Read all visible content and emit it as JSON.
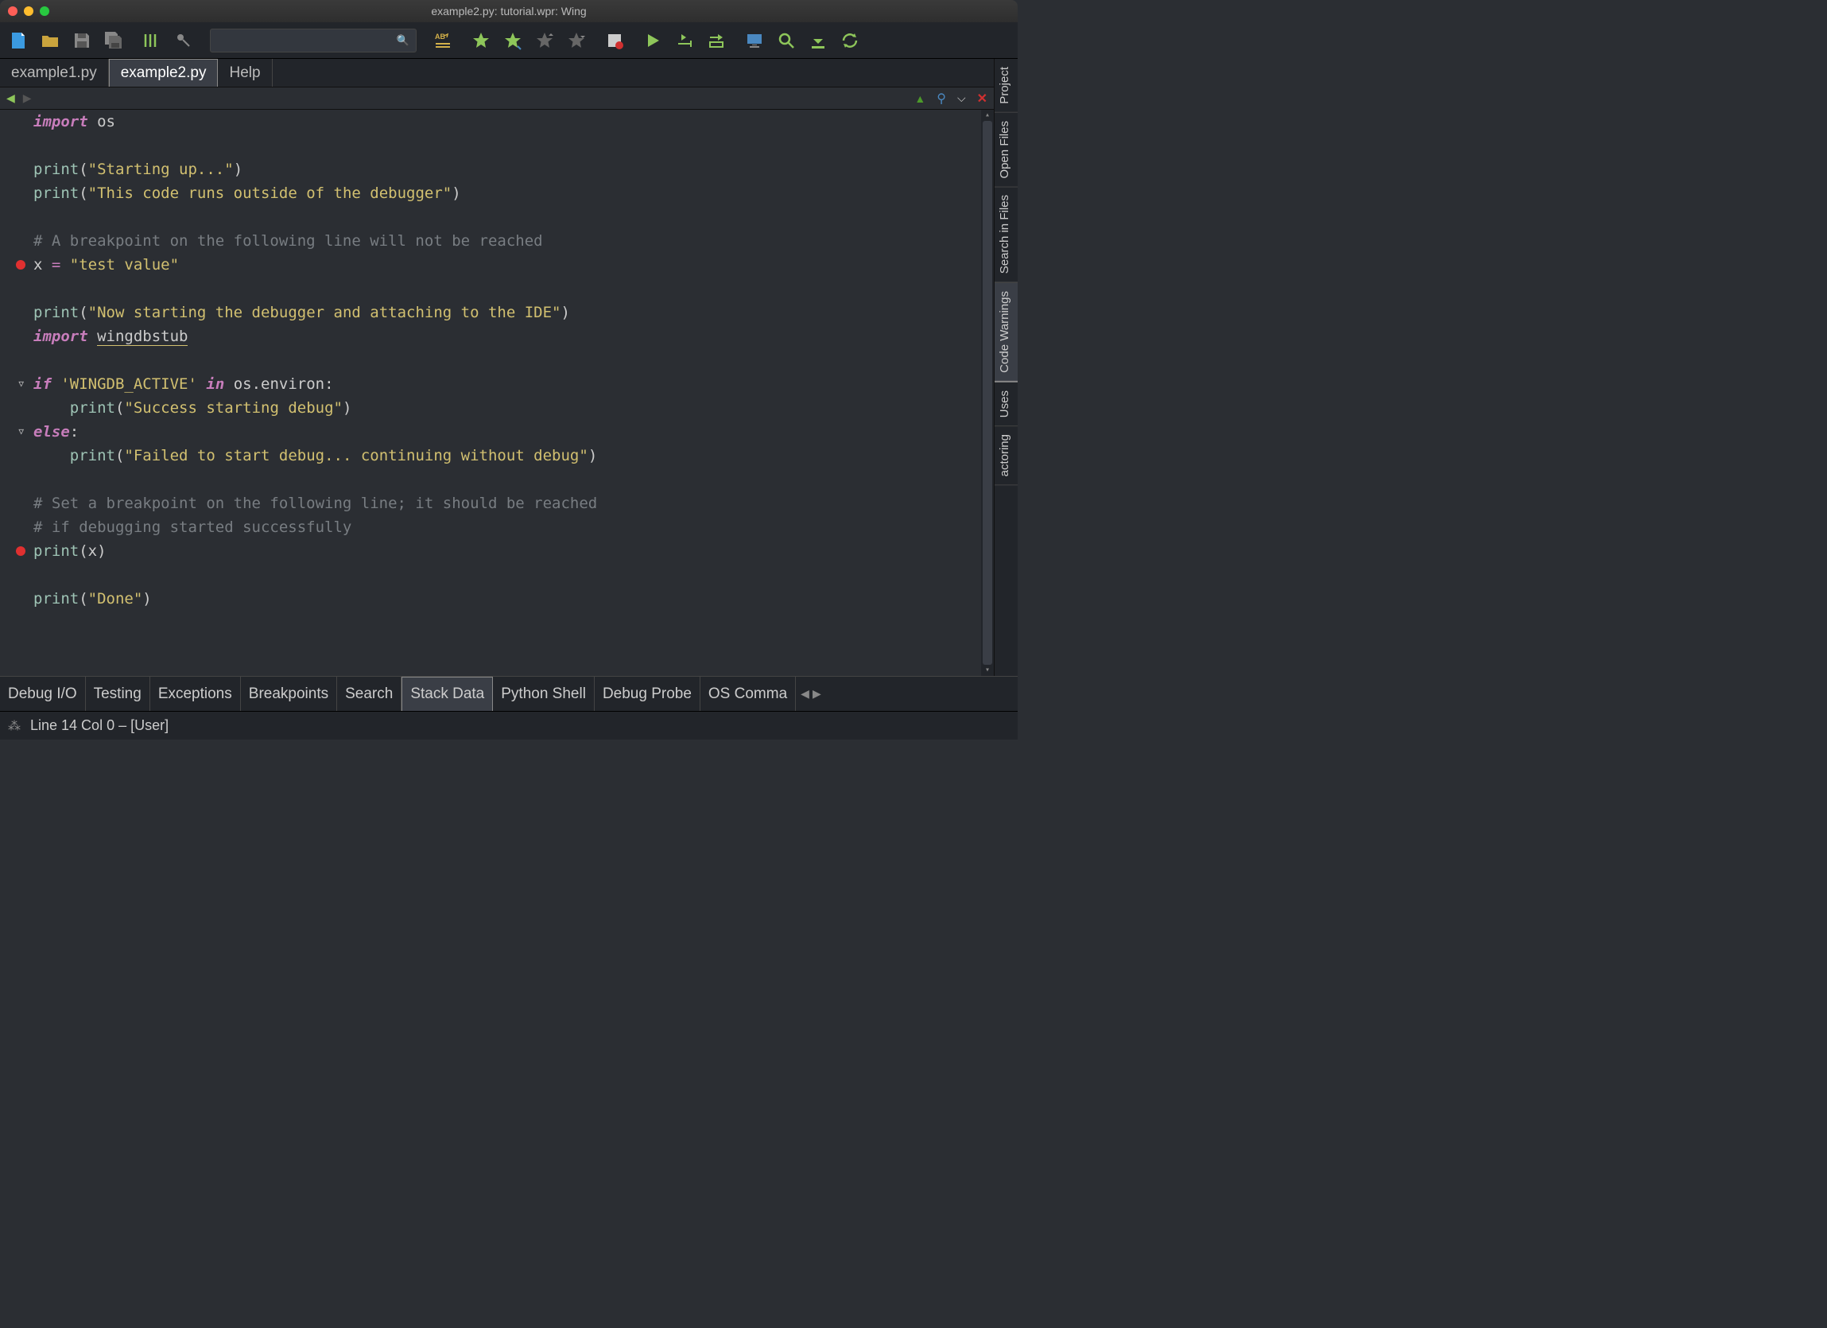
{
  "window": {
    "title": "example2.py: tutorial.wpr: Wing"
  },
  "file_tabs": {
    "items": [
      "example1.py",
      "example2.py",
      "Help"
    ],
    "active": 1
  },
  "side_tabs": {
    "items": [
      "Project",
      "Open Files",
      "Search in Files",
      "Code Warnings",
      "Uses",
      "actoring"
    ],
    "active": 3
  },
  "bottom_tabs": {
    "items": [
      "Debug I/O",
      "Testing",
      "Exceptions",
      "Breakpoints",
      "Search",
      "Stack Data",
      "Python Shell",
      "Debug Probe",
      "OS Comma"
    ],
    "active": 5
  },
  "status": {
    "text": "Line 14 Col 0 – [User]"
  },
  "code": {
    "lines": [
      {
        "bp": false,
        "fold": "",
        "tokens": [
          {
            "t": "kw",
            "v": "import"
          },
          {
            "t": "ident",
            "v": " os"
          }
        ]
      },
      {
        "bp": false,
        "fold": "",
        "tokens": []
      },
      {
        "bp": false,
        "fold": "",
        "tokens": [
          {
            "t": "fn",
            "v": "print"
          },
          {
            "t": "ident",
            "v": "("
          },
          {
            "t": "str",
            "v": "\"Starting up...\""
          },
          {
            "t": "ident",
            "v": ")"
          }
        ]
      },
      {
        "bp": false,
        "fold": "",
        "tokens": [
          {
            "t": "fn",
            "v": "print"
          },
          {
            "t": "ident",
            "v": "("
          },
          {
            "t": "str",
            "v": "\"This code runs outside of the debugger\""
          },
          {
            "t": "ident",
            "v": ")"
          }
        ]
      },
      {
        "bp": false,
        "fold": "",
        "tokens": []
      },
      {
        "bp": false,
        "fold": "",
        "tokens": [
          {
            "t": "cmt",
            "v": "# A breakpoint on the following line will not be reached"
          }
        ]
      },
      {
        "bp": true,
        "fold": "",
        "tokens": [
          {
            "t": "ident",
            "v": "x "
          },
          {
            "t": "op",
            "v": "="
          },
          {
            "t": "ident",
            "v": " "
          },
          {
            "t": "str",
            "v": "\"test value\""
          }
        ]
      },
      {
        "bp": false,
        "fold": "",
        "tokens": []
      },
      {
        "bp": false,
        "fold": "",
        "tokens": [
          {
            "t": "fn",
            "v": "print"
          },
          {
            "t": "ident",
            "v": "("
          },
          {
            "t": "str",
            "v": "\"Now starting the debugger and attaching to the IDE\""
          },
          {
            "t": "ident",
            "v": ")"
          }
        ]
      },
      {
        "bp": false,
        "fold": "",
        "tokens": [
          {
            "t": "kw",
            "v": "import"
          },
          {
            "t": "ident",
            "v": " "
          },
          {
            "t": "underline",
            "v": "wingdbstub"
          }
        ]
      },
      {
        "bp": false,
        "fold": "",
        "tokens": []
      },
      {
        "bp": false,
        "fold": "▽",
        "tokens": [
          {
            "t": "kw",
            "v": "if"
          },
          {
            "t": "ident",
            "v": " "
          },
          {
            "t": "str",
            "v": "'WINGDB_ACTIVE'"
          },
          {
            "t": "ident",
            "v": " "
          },
          {
            "t": "kw",
            "v": "in"
          },
          {
            "t": "ident",
            "v": " os.environ:"
          }
        ]
      },
      {
        "bp": false,
        "fold": "",
        "indent": 1,
        "tokens": [
          {
            "t": "fn",
            "v": "print"
          },
          {
            "t": "ident",
            "v": "("
          },
          {
            "t": "str",
            "v": "\"Success starting debug\""
          },
          {
            "t": "ident",
            "v": ")"
          }
        ]
      },
      {
        "bp": false,
        "fold": "▽",
        "tokens": [
          {
            "t": "kw",
            "v": "else"
          },
          {
            "t": "ident",
            "v": ":"
          }
        ]
      },
      {
        "bp": false,
        "fold": "",
        "indent": 1,
        "tokens": [
          {
            "t": "fn",
            "v": "print"
          },
          {
            "t": "ident",
            "v": "("
          },
          {
            "t": "str",
            "v": "\"Failed to start debug... continuing without debug\""
          },
          {
            "t": "ident",
            "v": ")"
          }
        ]
      },
      {
        "bp": false,
        "fold": "",
        "tokens": []
      },
      {
        "bp": false,
        "fold": "",
        "tokens": [
          {
            "t": "cmt",
            "v": "# Set a breakpoint on the following line; it should be reached"
          }
        ]
      },
      {
        "bp": false,
        "fold": "",
        "tokens": [
          {
            "t": "cmt",
            "v": "# if debugging started successfully"
          }
        ]
      },
      {
        "bp": true,
        "fold": "",
        "tokens": [
          {
            "t": "fn",
            "v": "print"
          },
          {
            "t": "ident",
            "v": "(x)"
          }
        ]
      },
      {
        "bp": false,
        "fold": "",
        "tokens": []
      },
      {
        "bp": false,
        "fold": "",
        "tokens": [
          {
            "t": "fn",
            "v": "print"
          },
          {
            "t": "ident",
            "v": "("
          },
          {
            "t": "str",
            "v": "\"Done\""
          },
          {
            "t": "ident",
            "v": ")"
          }
        ]
      },
      {
        "bp": false,
        "fold": "",
        "tokens": []
      },
      {
        "bp": false,
        "fold": "",
        "tokens": []
      }
    ]
  }
}
